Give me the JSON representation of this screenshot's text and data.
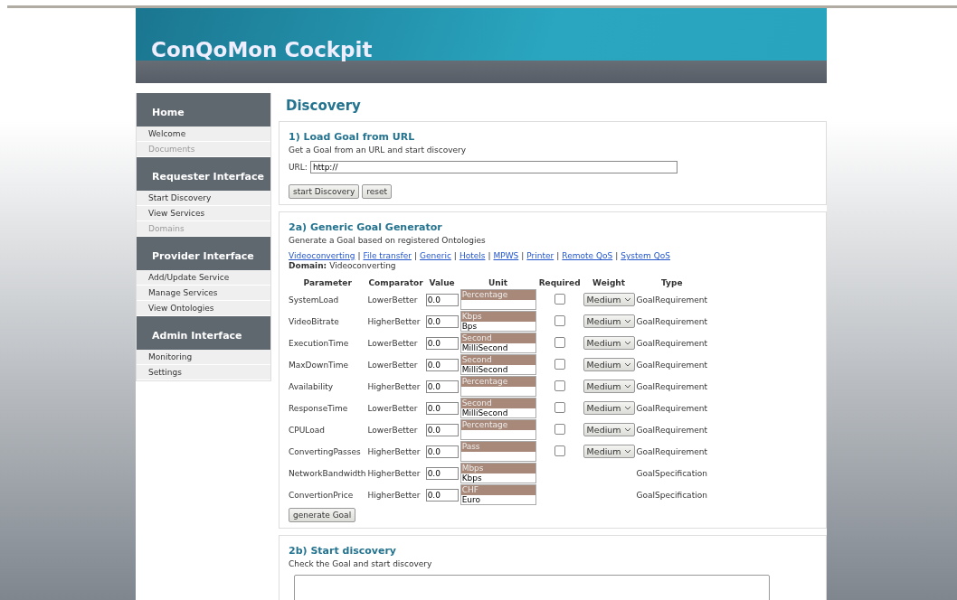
{
  "header": {
    "title": "ConQoMon Cockpit"
  },
  "sidebar": [
    {
      "heading": "Home",
      "items": [
        {
          "label": "Welcome",
          "disabled": false
        },
        {
          "label": "Documents",
          "disabled": true
        }
      ]
    },
    {
      "heading": "Requester Interface",
      "items": [
        {
          "label": "Start Discovery",
          "disabled": false
        },
        {
          "label": "View Services",
          "disabled": false
        },
        {
          "label": "Domains",
          "disabled": true
        }
      ]
    },
    {
      "heading": "Provider Interface",
      "items": [
        {
          "label": "Add/Update Service",
          "disabled": false
        },
        {
          "label": "Manage Services",
          "disabled": false
        },
        {
          "label": "View Ontologies",
          "disabled": false
        }
      ]
    },
    {
      "heading": "Admin Interface",
      "items": [
        {
          "label": "Monitoring",
          "disabled": false
        },
        {
          "label": "Settings",
          "disabled": false
        }
      ]
    }
  ],
  "page_title": "Discovery",
  "load_goal": {
    "title": "1) Load Goal from URL",
    "description": "Get a Goal from an URL and start discovery",
    "url_label": "URL:",
    "url_value": "http://",
    "buttons": [
      "start Discovery",
      "reset"
    ]
  },
  "generator": {
    "title": "2a) Generic Goal Generator",
    "description": "Generate a Goal based on registered Ontologies",
    "domains": [
      "Videoconverting",
      "File transfer",
      "Generic",
      "Hotels",
      "MPWS",
      "Printer",
      "Remote QoS",
      "System QoS"
    ],
    "link_separator": "|",
    "domain_label": "Domain:",
    "domain_value": "Videoconverting",
    "columns": [
      "Parameter",
      "Comparator",
      "Value",
      "Unit",
      "Required",
      "Weight",
      "Type"
    ],
    "rows": [
      {
        "parameter": "SystemLoad",
        "comparator": "LowerBetter",
        "value": "0.0",
        "units": [
          {
            "label": "Percentage",
            "selected": true
          }
        ],
        "required": false,
        "weight": "Medium",
        "type": "GoalRequirement"
      },
      {
        "parameter": "VideoBitrate",
        "comparator": "HigherBetter",
        "value": "0.0",
        "units": [
          {
            "label": "Kbps",
            "selected": true
          },
          {
            "label": "Bps",
            "selected": false
          }
        ],
        "required": false,
        "weight": "Medium",
        "type": "GoalRequirement"
      },
      {
        "parameter": "ExecutionTime",
        "comparator": "LowerBetter",
        "value": "0.0",
        "units": [
          {
            "label": "Second",
            "selected": true
          },
          {
            "label": "MilliSecond",
            "selected": false
          }
        ],
        "required": false,
        "weight": "Medium",
        "type": "GoalRequirement"
      },
      {
        "parameter": "MaxDownTime",
        "comparator": "LowerBetter",
        "value": "0.0",
        "units": [
          {
            "label": "Second",
            "selected": true
          },
          {
            "label": "MilliSecond",
            "selected": false
          }
        ],
        "required": false,
        "weight": "Medium",
        "type": "GoalRequirement"
      },
      {
        "parameter": "Availability",
        "comparator": "HigherBetter",
        "value": "0.0",
        "units": [
          {
            "label": "Percentage",
            "selected": true
          }
        ],
        "required": false,
        "weight": "Medium",
        "type": "GoalRequirement"
      },
      {
        "parameter": "ResponseTime",
        "comparator": "LowerBetter",
        "value": "0.0",
        "units": [
          {
            "label": "Second",
            "selected": true
          },
          {
            "label": "MilliSecond",
            "selected": false
          }
        ],
        "required": false,
        "weight": "Medium",
        "type": "GoalRequirement"
      },
      {
        "parameter": "CPULoad",
        "comparator": "LowerBetter",
        "value": "0.0",
        "units": [
          {
            "label": "Percentage",
            "selected": true
          }
        ],
        "required": false,
        "weight": "Medium",
        "type": "GoalRequirement"
      },
      {
        "parameter": "ConvertingPasses",
        "comparator": "HigherBetter",
        "value": "0.0",
        "units": [
          {
            "label": "Pass",
            "selected": true
          }
        ],
        "required": false,
        "weight": "Medium",
        "type": "GoalRequirement"
      },
      {
        "parameter": "NetworkBandwidth",
        "comparator": "HigherBetter",
        "value": "0.0",
        "units": [
          {
            "label": "Mbps",
            "selected": true
          },
          {
            "label": "Kbps",
            "selected": false
          }
        ],
        "type": "GoalSpecification"
      },
      {
        "parameter": "ConvertionPrice",
        "comparator": "HigherBetter",
        "value": "0.0",
        "units": [
          {
            "label": "CHF",
            "selected": true
          },
          {
            "label": "Euro",
            "selected": false
          }
        ],
        "type": "GoalSpecification"
      }
    ],
    "button": "generate Goal"
  },
  "start": {
    "title": "2b) Start discovery",
    "description": "Check the Goal and start discovery"
  }
}
